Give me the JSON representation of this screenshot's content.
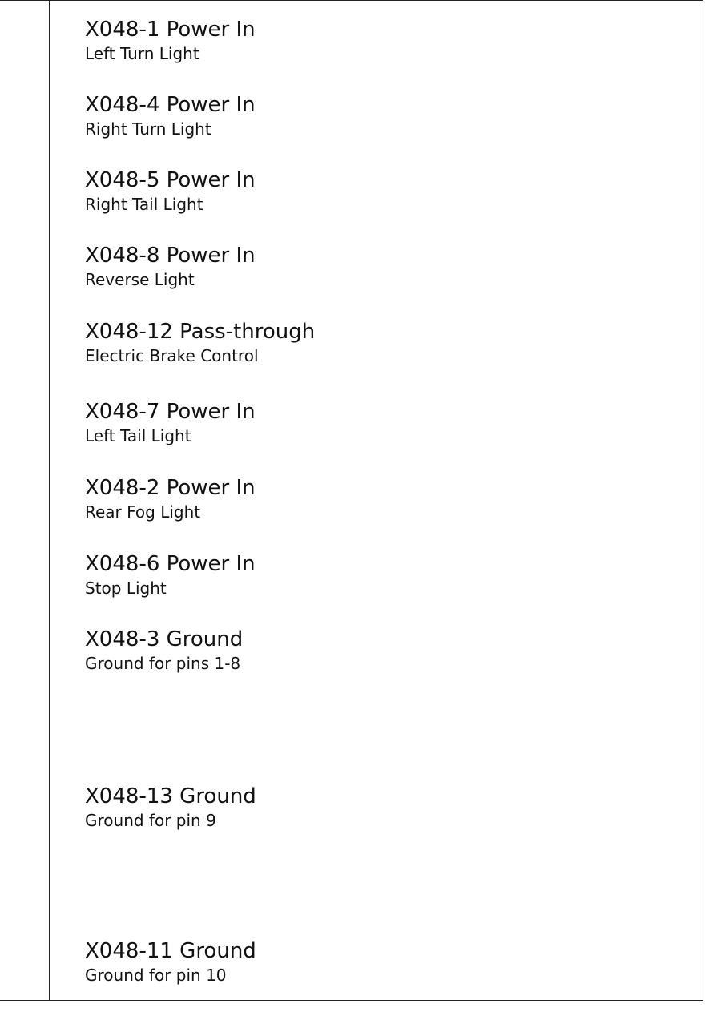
{
  "pins": [
    {
      "title": "X048-1 Power In",
      "description": "Left Turn Light"
    },
    {
      "title": "X048-4 Power In",
      "description": "Right Turn Light"
    },
    {
      "title": "X048-5 Power In",
      "description": "Right Tail Light"
    },
    {
      "title": "X048-8 Power In",
      "description": "Reverse Light"
    },
    {
      "title": "X048-12 Pass-through",
      "description": "Electric Brake Control"
    },
    {
      "title": "X048-7 Power In",
      "description": "Left Tail Light"
    },
    {
      "title": "X048-2 Power In",
      "description": "Rear Fog Light"
    },
    {
      "title": "X048-6 Power In",
      "description": "Stop Light"
    },
    {
      "title": "X048-3 Ground",
      "description": "Ground for pins 1-8"
    },
    {
      "title": "X048-13 Ground",
      "description": "Ground for pin 9"
    },
    {
      "title": "X048-11 Ground",
      "description": "Ground for pin 10"
    }
  ]
}
